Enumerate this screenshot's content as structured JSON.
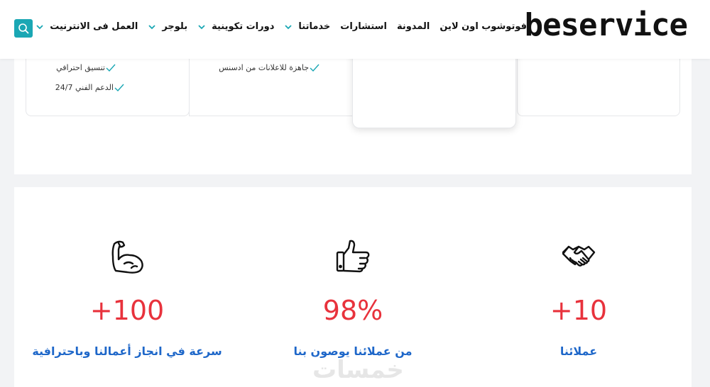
{
  "header": {
    "logo": "beservice",
    "nav": [
      {
        "label": "العمل فى الانترنيت",
        "dropdown": true
      },
      {
        "label": "بلوجر",
        "dropdown": true
      },
      {
        "label": "دورات تكوينية",
        "dropdown": true
      },
      {
        "label": "خدماتنا",
        "dropdown": true
      },
      {
        "label": "استشارات",
        "dropdown": false
      },
      {
        "label": "المدونة",
        "dropdown": false
      },
      {
        "label": "فوتوشوب اون لاين",
        "dropdown": false
      }
    ],
    "search_icon": "search-icon"
  },
  "pricing": {
    "plan_1_features": [
      "تنسيق احترافي",
      "الدعم الفني 24/7"
    ],
    "plan_2_features": [
      "جاهزة للاعلانات من ادسنس"
    ]
  },
  "stats": [
    {
      "icon": "handshake-icon",
      "value": "+10",
      "label": "عملائنا"
    },
    {
      "icon": "thumbs-up-icon",
      "value": "98%",
      "label": "من عملائنا يوصون بنا"
    },
    {
      "icon": "flexed-arm-icon",
      "value": "+100",
      "label": "سرعة في انجاز أعمالنا وباحترافية"
    }
  ],
  "watermark": "خمسات",
  "colors": {
    "accent": "#1aa7b4",
    "stat_value": "#e8323c",
    "stat_label": "#1e67c9"
  }
}
